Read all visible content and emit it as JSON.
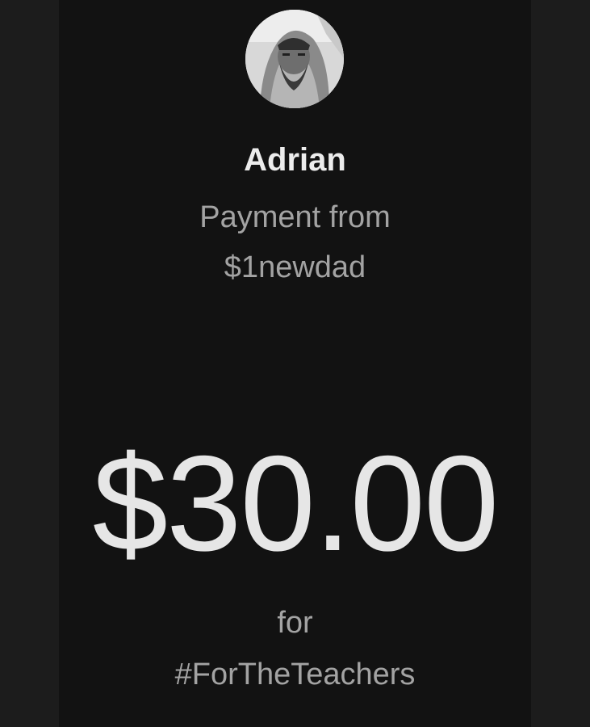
{
  "payment": {
    "recipient_name": "Adrian",
    "line1": "Payment from",
    "sender_handle": "$1newdad",
    "amount": "$30.00",
    "for_label": "for",
    "note": "#ForTheTeachers"
  },
  "icons": {
    "avatar": "user-avatar-photo"
  },
  "colors": {
    "page_background": "#1c1c1c",
    "panel_background": "#121212",
    "primary_text": "#ececec",
    "secondary_text": "#a3a3a3",
    "amount_text": "#e6e6e6"
  }
}
